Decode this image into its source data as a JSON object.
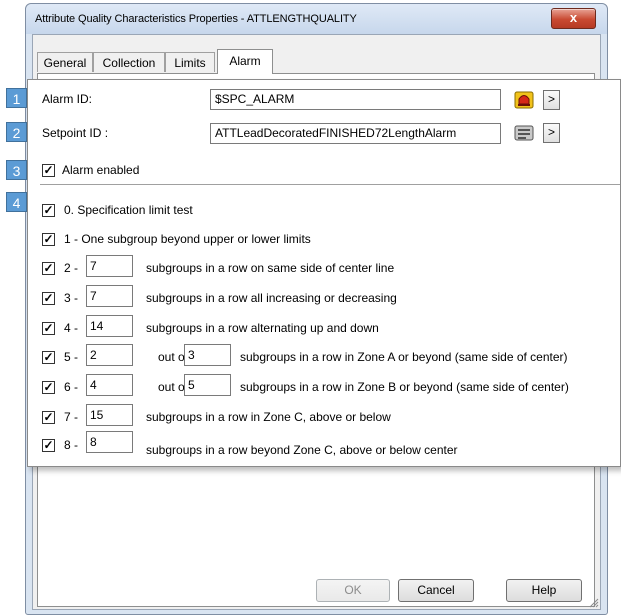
{
  "window": {
    "title": "Attribute Quality Characteristics Properties - ATTLENGTHQUALITY",
    "close_label": "x"
  },
  "tabs": [
    {
      "label": "General"
    },
    {
      "label": "Collection"
    },
    {
      "label": "Limits"
    },
    {
      "label": "Alarm",
      "active": true
    }
  ],
  "buttons": {
    "ok": "OK",
    "cancel": "Cancel",
    "help": "Help"
  },
  "callouts": [
    "1",
    "2",
    "3",
    "4"
  ],
  "alarm": {
    "alarm_id_label": "Alarm ID:",
    "alarm_id_value": "$SPC_ALARM",
    "setpoint_label": "Setpoint ID :",
    "setpoint_value": "ATTLeadDecoratedFINISHED72LengthAlarm",
    "browse_label": ">",
    "alarm_enabled_label": "Alarm enabled",
    "alarm_enabled_checked": true
  },
  "rules": [
    {
      "checked": true,
      "prefix": "0. Specification limit test"
    },
    {
      "checked": true,
      "prefix": "1 - One subgroup beyond upper or lower limits"
    },
    {
      "checked": true,
      "prefix": "2 -",
      "value": "7",
      "text": "subgroups in a row on same side of center line"
    },
    {
      "checked": true,
      "prefix": "3 -",
      "value": "7",
      "text": "subgroups in a row all increasing or decreasing"
    },
    {
      "checked": true,
      "prefix": "4 -",
      "value": "14",
      "text": "subgroups in a row alternating up and down"
    },
    {
      "checked": true,
      "prefix": "5 -",
      "value": "2",
      "out_of_label": "out of",
      "out_of_value": "3",
      "text": "subgroups in a row in Zone A or beyond (same side of center)"
    },
    {
      "checked": true,
      "prefix": "6 -",
      "value": "4",
      "out_of_label": "out of",
      "out_of_value": "5",
      "text": "subgroups in a row in Zone B or beyond (same side of center)"
    },
    {
      "checked": true,
      "prefix": "7 -",
      "value": "15",
      "text": "subgroups in a row in Zone C, above or below"
    },
    {
      "checked": true,
      "prefix": "8 -",
      "value": "8",
      "text": "subgroups in a row beyond Zone C, above or below center"
    }
  ],
  "check_mark": "✓",
  "colors": {
    "callout_blue": "#5b9bd5",
    "window_frame": "#d9e4f1",
    "close_red": "#c94a32"
  }
}
